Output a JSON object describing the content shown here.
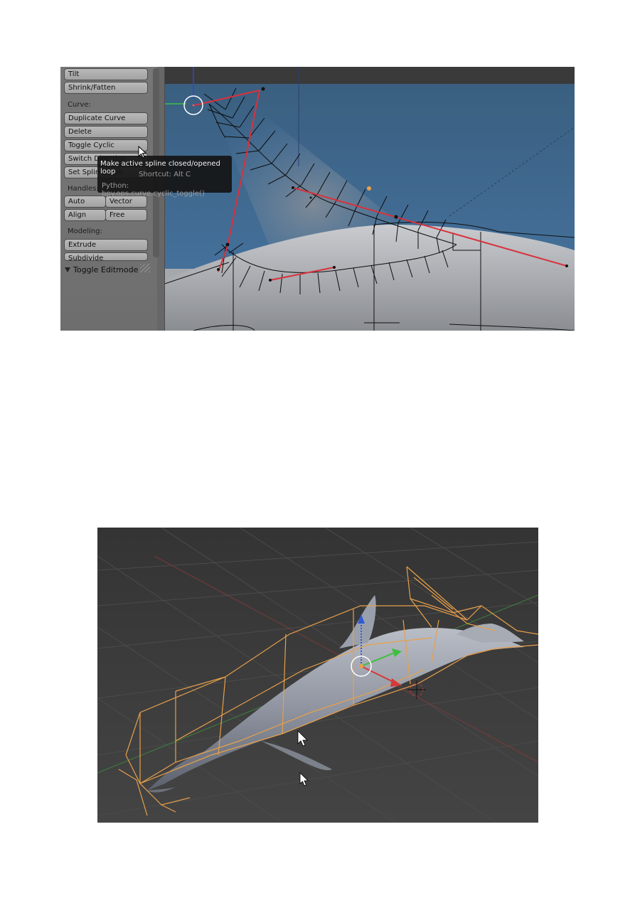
{
  "panel": {
    "buttons_top": [
      "Tilt",
      "Shrink/Fatten"
    ],
    "curve_label": "Curve:",
    "curve_buttons": [
      "Duplicate Curve",
      "Delete",
      "Toggle Cyclic",
      "Switch Direction",
      "Set Spline Type"
    ],
    "handles_label": "Handles:",
    "handles_buttons": [
      "Auto",
      "Vector",
      "Align",
      "Free"
    ],
    "modeling_label": "Modeling:",
    "modeling_buttons": [
      "Extrude",
      "Subdivide"
    ],
    "toggle_editmode": "Toggle Editmode"
  },
  "tooltip": {
    "title": "Make active spline closed/opened loop",
    "shortcut": "Shortcut: Alt C",
    "python": "Python: bpy.ops.curve.cyclic_toggle()"
  },
  "colors": {
    "curve_handle": "#d8323c",
    "lattice": "#e8a04a",
    "sky": "#3e6a8e",
    "viewport_bg": "#3c3c3c",
    "axis_blue": "#2f5bd8",
    "axis_green": "#3fbf3f",
    "axis_red": "#d33a3a"
  },
  "icons": {
    "cursor": "mouse-pointer-icon",
    "expand": "triangle-down-icon",
    "grip": "resize-grip-icon"
  }
}
